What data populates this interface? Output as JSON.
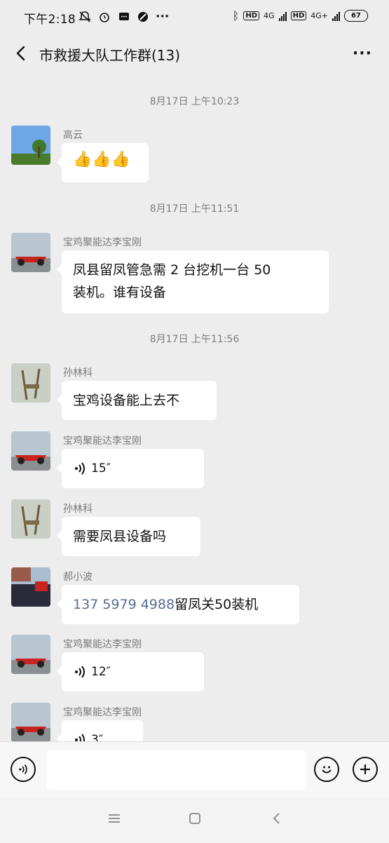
{
  "status": {
    "time": "下午2:18",
    "battery": "67",
    "hd1": "HD",
    "hd2": "HD",
    "net1": "4G",
    "net2": "4G+"
  },
  "header": {
    "title": "市救援大队工作群(13)",
    "more": "···"
  },
  "chat": {
    "timestamps": [
      "8月17日 上午10:23",
      "8月17日 上午11:51",
      "8月17日 上午11:56"
    ],
    "messages": [
      {
        "name": "高云",
        "text": "👍👍👍"
      },
      {
        "name": "宝鸡聚能达李宝刚",
        "text_line1": "凤县留凤管急需 2 台挖机一台 50",
        "text_line2": "装机。谁有设备"
      },
      {
        "name": "孙林科",
        "text": "宝鸡设备能上去不"
      },
      {
        "name": "宝鸡聚能达李宝刚",
        "voice": "15″"
      },
      {
        "name": "孙林科",
        "text": "需要凤县设备吗"
      },
      {
        "name": "郝小波",
        "phone": "137 5979 4988",
        "text": "留凤关50装机"
      },
      {
        "name": "宝鸡聚能达李宝刚",
        "voice": "12″"
      },
      {
        "name": "宝鸡聚能达李宝刚",
        "voice": "3″"
      }
    ]
  },
  "input": {
    "placeholder": ""
  },
  "icons": {
    "back": "back-arrow-icon",
    "more": "more-icon",
    "voice": "voice-icon",
    "emoji": "emoji-icon",
    "plus": "plus-icon"
  }
}
